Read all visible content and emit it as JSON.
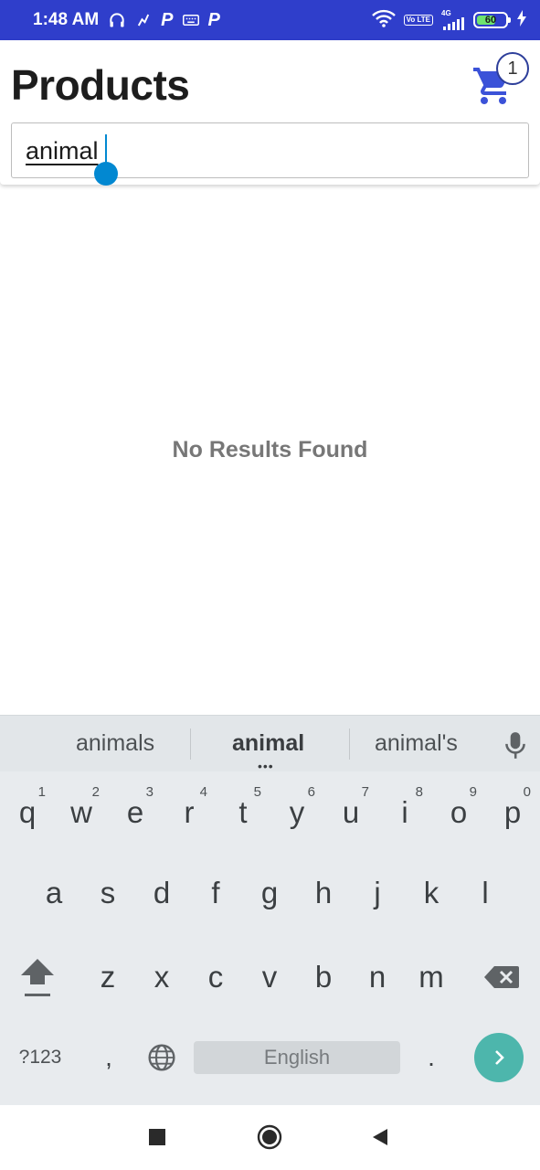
{
  "status_bar": {
    "time": "1:48 AM",
    "volte_label": "Vo LTE",
    "network_label": "4G",
    "battery_level": "60"
  },
  "header": {
    "title": "Products",
    "cart_count": "1"
  },
  "search": {
    "value": "animal"
  },
  "content": {
    "empty_message": "No Results Found"
  },
  "keyboard": {
    "suggestions": [
      "animals",
      "animal",
      "animal's"
    ],
    "row1": [
      {
        "key": "q",
        "hint": "1"
      },
      {
        "key": "w",
        "hint": "2"
      },
      {
        "key": "e",
        "hint": "3"
      },
      {
        "key": "r",
        "hint": "4"
      },
      {
        "key": "t",
        "hint": "5"
      },
      {
        "key": "y",
        "hint": "6"
      },
      {
        "key": "u",
        "hint": "7"
      },
      {
        "key": "i",
        "hint": "8"
      },
      {
        "key": "o",
        "hint": "9"
      },
      {
        "key": "p",
        "hint": "0"
      }
    ],
    "row2": [
      "a",
      "s",
      "d",
      "f",
      "g",
      "h",
      "j",
      "k",
      "l"
    ],
    "row3": [
      "z",
      "x",
      "c",
      "v",
      "b",
      "n",
      "m"
    ],
    "symbols_label": "?123",
    "comma_label": ",",
    "space_label": "English",
    "period_label": "."
  },
  "colors": {
    "status_bar": "#2f3ecb",
    "cart_icon": "#3b52d8",
    "caret": "#0288d1",
    "enter_key": "#4db6ac",
    "keyboard_bg": "#e8ebee"
  },
  "icons": [
    "headphones-icon",
    "p-app-icon",
    "keyboard-icon",
    "wifi-icon",
    "signal-icon",
    "battery-icon",
    "charging-icon",
    "cart-icon",
    "mic-icon",
    "shift-icon",
    "backspace-icon",
    "globe-icon",
    "enter-arrow-icon",
    "recents-icon",
    "home-icon",
    "back-icon"
  ]
}
